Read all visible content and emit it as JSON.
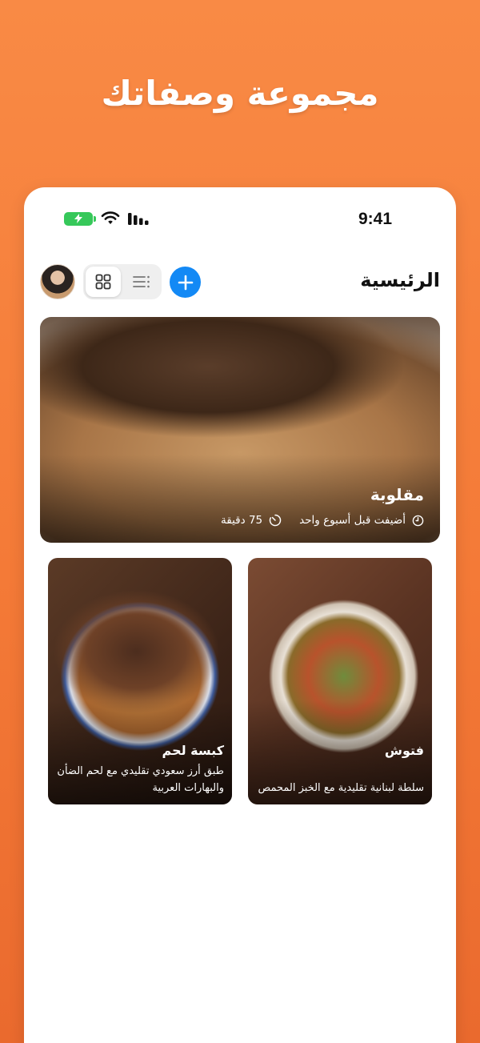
{
  "promo": {
    "title": "مجموعة وصفاتك"
  },
  "status_bar": {
    "time": "9:41"
  },
  "header": {
    "title": "الرئيسية",
    "avatar_icon": "user-avatar",
    "grid_view_icon": "grid-icon",
    "list_view_icon": "list-icon",
    "add_icon": "plus-icon",
    "active_view": "grid"
  },
  "featured_recipe": {
    "title": "مقلوبة",
    "duration": "75 دقيقة",
    "added": "أضيفت قبل أسبوع واحد",
    "timer_icon": "timer-icon",
    "clock_icon": "clock-icon"
  },
  "recipes": [
    {
      "title": "فتوش",
      "description": "سلطة لبنانية تقليدية مع الخبز المحمص"
    },
    {
      "title": "كبسة لحم",
      "description": "طبق أرز سعودي تقليدي مع لحم الضأن والبهارات العربية"
    }
  ],
  "colors": {
    "background": "#f47a37",
    "accent": "#1389f5",
    "battery": "#36c85a"
  }
}
